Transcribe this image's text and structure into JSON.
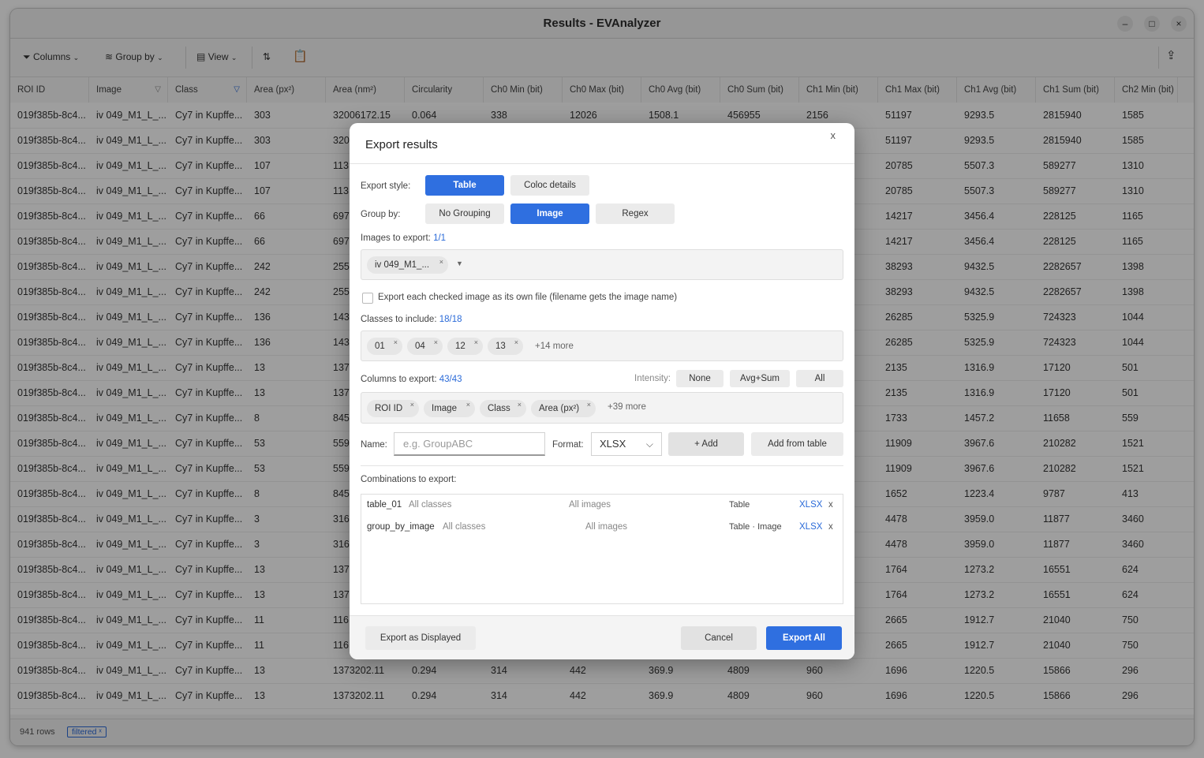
{
  "window": {
    "title": "Results - EVAnalyzer",
    "controls": {
      "minimize": "–",
      "maximize": "□",
      "close": "×"
    }
  },
  "toolbar": {
    "columns_label": "Columns",
    "group_by_label": "Group by",
    "view_label": "View"
  },
  "table": {
    "columns": [
      "ROI ID",
      "Image",
      "Class",
      "Area (px²)",
      "Area (nm²)",
      "Circularity",
      "Ch0 Min (bit)",
      "Ch0 Max (bit)",
      "Ch0 Avg (bit)",
      "Ch0 Sum (bit)",
      "Ch1 Min (bit)",
      "Ch1 Max (bit)",
      "Ch1 Avg (bit)",
      "Ch1 Sum (bit)",
      "Ch2 Min (bit)"
    ],
    "rows": [
      [
        "019f385b-8c4...",
        "iv 049_M1_L_...",
        "Cy7 in Kupffe...",
        "303",
        "32006172.15",
        "0.064",
        "338",
        "12026",
        "1508.1",
        "456955",
        "2156",
        "51197",
        "9293.5",
        "2815940",
        "1585"
      ],
      [
        "019f385b-8c4...",
        "iv 049_M1_L_...",
        "Cy7 in Kupffe...",
        "303",
        "320",
        "",
        "",
        "",
        "",
        "",
        "",
        "51197",
        "9293.5",
        "2815940",
        "1585"
      ],
      [
        "019f385b-8c4...",
        "iv 049_M1_L_...",
        "Cy7 in Kupffe...",
        "107",
        "113",
        "",
        "",
        "",
        "",
        "",
        "",
        "20785",
        "5507.3",
        "589277",
        "1310"
      ],
      [
        "019f385b-8c4...",
        "iv 049_M1_L_...",
        "Cy7 in Kupffe...",
        "107",
        "113",
        "",
        "",
        "",
        "",
        "",
        "",
        "20785",
        "5507.3",
        "589277",
        "1310"
      ],
      [
        "019f385b-8c4...",
        "iv 049_M1_L_...",
        "Cy7 in Kupffe...",
        "66",
        "697",
        "",
        "",
        "",
        "",
        "",
        "",
        "14217",
        "3456.4",
        "228125",
        "1165"
      ],
      [
        "019f385b-8c4...",
        "iv 049_M1_L_...",
        "Cy7 in Kupffe...",
        "66",
        "697",
        "",
        "",
        "",
        "",
        "",
        "",
        "14217",
        "3456.4",
        "228125",
        "1165"
      ],
      [
        "019f385b-8c4...",
        "iv 049_M1_L_...",
        "Cy7 in Kupffe...",
        "242",
        "255",
        "",
        "",
        "",
        "",
        "",
        "",
        "38293",
        "9432.5",
        "2282657",
        "1398"
      ],
      [
        "019f385b-8c4...",
        "iv 049_M1_L_...",
        "Cy7 in Kupffe...",
        "242",
        "255",
        "",
        "",
        "",
        "",
        "",
        "",
        "38293",
        "9432.5",
        "2282657",
        "1398"
      ],
      [
        "019f385b-8c4...",
        "iv 049_M1_L_...",
        "Cy7 in Kupffe...",
        "136",
        "143",
        "",
        "",
        "",
        "",
        "",
        "",
        "26285",
        "5325.9",
        "724323",
        "1044"
      ],
      [
        "019f385b-8c4...",
        "iv 049_M1_L_...",
        "Cy7 in Kupffe...",
        "136",
        "143",
        "",
        "",
        "",
        "",
        "",
        "",
        "26285",
        "5325.9",
        "724323",
        "1044"
      ],
      [
        "019f385b-8c4...",
        "iv 049_M1_L_...",
        "Cy7 in Kupffe...",
        "13",
        "137",
        "",
        "",
        "",
        "",
        "",
        "",
        "2135",
        "1316.9",
        "17120",
        "501"
      ],
      [
        "019f385b-8c4...",
        "iv 049_M1_L_...",
        "Cy7 in Kupffe...",
        "13",
        "137",
        "",
        "",
        "",
        "",
        "",
        "",
        "2135",
        "1316.9",
        "17120",
        "501"
      ],
      [
        "019f385b-8c4...",
        "iv 049_M1_L_...",
        "Cy7 in Kupffe...",
        "8",
        "845",
        "",
        "",
        "",
        "",
        "",
        "",
        "1733",
        "1457.2",
        "11658",
        "559"
      ],
      [
        "019f385b-8c4...",
        "iv 049_M1_L_...",
        "Cy7 in Kupffe...",
        "53",
        "559",
        "",
        "",
        "",
        "",
        "",
        "",
        "11909",
        "3967.6",
        "210282",
        "1521"
      ],
      [
        "019f385b-8c4...",
        "iv 049_M1_L_...",
        "Cy7 in Kupffe...",
        "53",
        "559",
        "",
        "",
        "",
        "",
        "",
        "",
        "11909",
        "3967.6",
        "210282",
        "1521"
      ],
      [
        "019f385b-8c4...",
        "iv 049_M1_L_...",
        "Cy7 in Kupffe...",
        "8",
        "845",
        "",
        "",
        "",
        "",
        "",
        "",
        "1652",
        "1223.4",
        "9787",
        "413"
      ],
      [
        "019f385b-8c4...",
        "iv 049_M1_L_...",
        "Cy7 in Kupffe...",
        "3",
        "316",
        "",
        "",
        "",
        "",
        "",
        "",
        "4478",
        "3959.0",
        "11877",
        "3460"
      ],
      [
        "019f385b-8c4...",
        "iv 049_M1_L_...",
        "Cy7 in Kupffe...",
        "3",
        "316",
        "",
        "",
        "",
        "",
        "",
        "",
        "4478",
        "3959.0",
        "11877",
        "3460"
      ],
      [
        "019f385b-8c4...",
        "iv 049_M1_L_...",
        "Cy7 in Kupffe...",
        "13",
        "137",
        "",
        "",
        "",
        "",
        "",
        "",
        "1764",
        "1273.2",
        "16551",
        "624"
      ],
      [
        "019f385b-8c4...",
        "iv 049_M1_L_...",
        "Cy7 in Kupffe...",
        "13",
        "137",
        "",
        "",
        "",
        "",
        "",
        "",
        "1764",
        "1273.2",
        "16551",
        "624"
      ],
      [
        "019f385b-8c4...",
        "iv 049_M1_L_...",
        "Cy7 in Kupffe...",
        "11",
        "116",
        "",
        "",
        "",
        "",
        "",
        "",
        "2665",
        "1912.7",
        "21040",
        "750"
      ],
      [
        "019f385b-8c4...",
        "iv 049_M1_L_...",
        "Cy7 in Kupffe...",
        "11",
        "116",
        "",
        "",
        "",
        "",
        "",
        "",
        "2665",
        "1912.7",
        "21040",
        "750"
      ],
      [
        "019f385b-8c4...",
        "iv 049_M1_L_...",
        "Cy7 in Kupffe...",
        "13",
        "1373202.11",
        "0.294",
        "314",
        "442",
        "369.9",
        "4809",
        "960",
        "1696",
        "1220.5",
        "15866",
        "296"
      ],
      [
        "019f385b-8c4...",
        "iv 049_M1_L_...",
        "Cy7 in Kupffe...",
        "13",
        "1373202.11",
        "0.294",
        "314",
        "442",
        "369.9",
        "4809",
        "960",
        "1696",
        "1220.5",
        "15866",
        "296"
      ]
    ]
  },
  "status": {
    "rows_text": "941 rows",
    "badge": "filtered"
  },
  "dialog": {
    "title": "Export results",
    "close": "x",
    "export_style": {
      "label": "Export style:",
      "options": [
        "Table",
        "Coloc details"
      ]
    },
    "group_by": {
      "label": "Group by:",
      "options": [
        "No Grouping",
        "Image",
        "Regex"
      ]
    },
    "images": {
      "label": "Images to export:",
      "count": "1/1",
      "chips": [
        "iv 049_M1_..."
      ]
    },
    "own_file_label": "Export each checked image as its own file (filename gets the image name)",
    "classes": {
      "label": "Classes to include:",
      "count": "18/18",
      "chips": [
        "01",
        "04",
        "12",
        "13"
      ],
      "more": "+14 more"
    },
    "columns": {
      "label": "Columns to export:",
      "count": "43/43",
      "intensity_label": "Intensity:",
      "intensity_options": [
        "None",
        "Avg+Sum",
        "All"
      ],
      "chips": [
        "ROI ID",
        "Image",
        "Class",
        "Area (px²)"
      ],
      "more": "+39 more"
    },
    "name_label": "Name:",
    "name_placeholder": "e.g. GroupABC",
    "format_label": "Format:",
    "format_value": "XLSX",
    "add_label": "+ Add",
    "add_from_table_label": "Add from table",
    "combinations_label": "Combinations to export:",
    "combinations": [
      {
        "name": "table_01",
        "classes": "All classes",
        "images": "All images",
        "type": "Table",
        "format": "XLSX",
        "remove": "x"
      },
      {
        "name": "group_by_image",
        "classes": "All classes",
        "images": "All images",
        "type": "Table · Image",
        "format": "XLSX",
        "remove": "x"
      }
    ],
    "export_displayed_label": "Export as Displayed",
    "cancel_label": "Cancel",
    "export_all_label": "Export All"
  },
  "colors": {
    "accent": "#2f6fe0",
    "link": "#2a6ad8"
  }
}
